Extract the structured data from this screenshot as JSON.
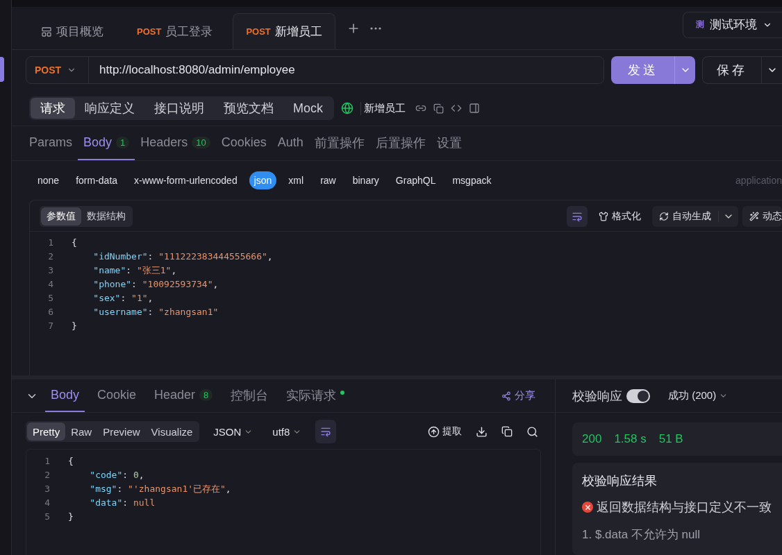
{
  "tabs": [
    {
      "kind": "overview",
      "label": "项目概览",
      "selected": false
    },
    {
      "kind": "request",
      "method": "POST",
      "label": "员工登录",
      "selected": false
    },
    {
      "kind": "request",
      "method": "POST",
      "label": "新增员工",
      "selected": true
    }
  ],
  "environment": {
    "badge": "测",
    "label": "测试环境"
  },
  "url_bar": {
    "method": "POST",
    "url": "http://localhost:8080/admin/employee",
    "send": "发送",
    "save": "保存"
  },
  "view_tabs": [
    {
      "label": "请求",
      "selected": true
    },
    {
      "label": "响应定义",
      "selected": false
    },
    {
      "label": "接口说明",
      "selected": false
    },
    {
      "label": "预览文档",
      "selected": false
    },
    {
      "label": "Mock",
      "selected": false
    }
  ],
  "endpoint_name": "新增员工",
  "request_tabs": [
    {
      "label": "Params",
      "selected": false
    },
    {
      "label": "Body",
      "count": "1",
      "selected": true
    },
    {
      "label": "Headers",
      "count": "10",
      "selected": false
    },
    {
      "label": "Cookies",
      "selected": false
    },
    {
      "label": "Auth",
      "selected": false
    },
    {
      "label": "前置操作",
      "selected": false
    },
    {
      "label": "后置操作",
      "selected": false
    },
    {
      "label": "设置",
      "selected": false
    }
  ],
  "body_types": [
    {
      "label": "none",
      "selected": false
    },
    {
      "label": "form-data",
      "selected": false
    },
    {
      "label": "x-www-form-urlencoded",
      "selected": false
    },
    {
      "label": "json",
      "selected": true
    },
    {
      "label": "xml",
      "selected": false
    },
    {
      "label": "raw",
      "selected": false
    },
    {
      "label": "binary",
      "selected": false
    },
    {
      "label": "GraphQL",
      "selected": false
    },
    {
      "label": "msgpack",
      "selected": false
    }
  ],
  "content_type": "application",
  "editor_tabs": [
    {
      "label": "参数值",
      "selected": true
    },
    {
      "label": "数据结构",
      "selected": false
    }
  ],
  "editor_actions": {
    "format": "格式化",
    "auto_generate": "自动生成",
    "dynamic": "动态"
  },
  "request_body": [
    {
      "number": "1",
      "text": "{"
    },
    {
      "number": "2",
      "text": "    \"idNumber\": \"111222383444555666\","
    },
    {
      "number": "3",
      "text": "    \"name\": \"张三1\","
    },
    {
      "number": "4",
      "text": "    \"phone\": \"10092593734\","
    },
    {
      "number": "5",
      "text": "    \"sex\": \"1\","
    },
    {
      "number": "6",
      "text": "    \"username\": \"zhangsan1\""
    },
    {
      "number": "7",
      "text": "}"
    }
  ],
  "response_tabs": [
    {
      "label": "Body",
      "selected": true
    },
    {
      "label": "Cookie",
      "selected": false
    },
    {
      "label": "Header",
      "count": "8",
      "selected": false
    },
    {
      "label": "控制台",
      "selected": false
    },
    {
      "label": "实际请求",
      "dot": true,
      "selected": false
    }
  ],
  "share": "分享",
  "view_modes": [
    {
      "label": "Pretty",
      "selected": true
    },
    {
      "label": "Raw",
      "selected": false
    },
    {
      "label": "Preview",
      "selected": false
    },
    {
      "label": "Visualize",
      "selected": false
    }
  ],
  "format_select": "JSON",
  "encoding_select": "utf8",
  "extract": "提取",
  "response_body": [
    {
      "number": "1",
      "text": "{"
    },
    {
      "number": "2",
      "text": "    \"code\": 0,"
    },
    {
      "number": "3",
      "text": "    \"msg\": \"'zhangsan1'已存在\","
    },
    {
      "number": "4",
      "text": "    \"data\": null"
    },
    {
      "number": "5",
      "text": "}"
    }
  ],
  "validation": {
    "label": "校验响应",
    "on": true,
    "status_select": "成功 (200)",
    "status_code": "200",
    "time": "1.58 s",
    "size": "51 B",
    "result_title": "校验响应结果",
    "error": "返回数据结构与接口定义不一致",
    "detail": "1. $.data 不允许为 null"
  }
}
